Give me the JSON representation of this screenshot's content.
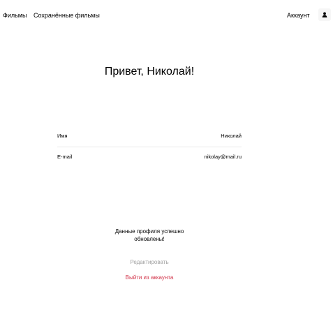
{
  "header": {
    "nav": {
      "movies_label": "Фильмы",
      "saved_label": "Сохранённые фильмы"
    },
    "account_label": "Аккаунт",
    "account_icon": "user-icon"
  },
  "profile": {
    "greeting": "Привет, Николай!",
    "fields": [
      {
        "label": "Имя",
        "value": "Николай"
      },
      {
        "label": "E-mail",
        "value": "nikolay@mail.ru"
      }
    ],
    "status_message": "Данные профиля успешно обновлены!",
    "edit_label": "Редактировать",
    "logout_label": "Выйти из аккаунта"
  },
  "colors": {
    "logout": "#d2344a",
    "edit_disabled": "#a0a0a0",
    "divider": "#e8e8e8"
  }
}
